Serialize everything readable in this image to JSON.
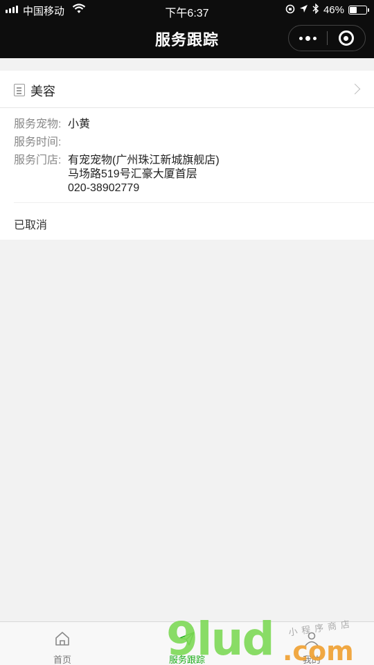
{
  "status_bar": {
    "carrier": "中国移动",
    "time": "下午6:37",
    "battery": "46%",
    "battery_level": 0.46
  },
  "navbar": {
    "title": "服务跟踪"
  },
  "service": {
    "category": "美容",
    "pet_label": "服务宠物:",
    "pet_value": "小黄",
    "time_label": "服务时间:",
    "time_value": "",
    "store_label": "服务门店:",
    "store_name": "有宠宠物(广州珠江新城旗舰店)",
    "store_address": "马场路519号汇豪大厦首层",
    "store_phone": "020-38902779",
    "status": "已取消"
  },
  "tabbar": {
    "items": [
      {
        "label": "首页",
        "icon": "home-icon"
      },
      {
        "label": "服务跟踪",
        "icon": "send-icon"
      },
      {
        "label": "我的",
        "icon": "user-icon"
      }
    ],
    "active_color": "#1aad19"
  },
  "watermark": {
    "brand": "9lud",
    "suffix": ".com",
    "tagline": "小程序商店"
  }
}
